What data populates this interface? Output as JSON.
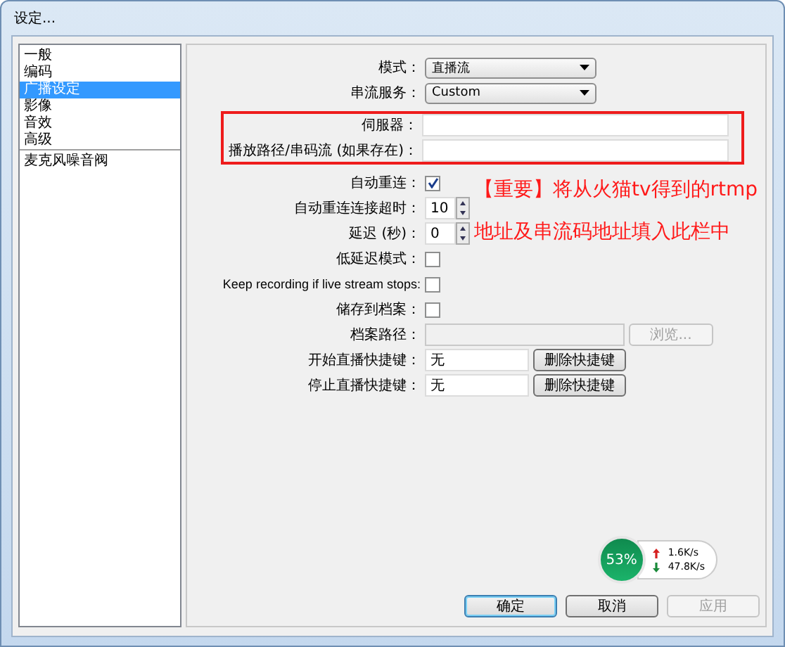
{
  "window": {
    "title": "设定..."
  },
  "sidebar": {
    "sections": [
      {
        "items": [
          {
            "label": "一般",
            "selected": false
          },
          {
            "label": "编码",
            "selected": false
          },
          {
            "label": "广播设定",
            "selected": true
          },
          {
            "label": "影像",
            "selected": false
          },
          {
            "label": "音效",
            "selected": false
          },
          {
            "label": "高级",
            "selected": false
          }
        ]
      },
      {
        "items": [
          {
            "label": "麦克风噪音阀",
            "selected": false
          }
        ]
      }
    ]
  },
  "form": [
    {
      "highlight": false,
      "rows": [
        {
          "kind": "select",
          "label": "模式：",
          "value": "直播流"
        },
        {
          "kind": "select",
          "label": "串流服务：",
          "value": "Custom"
        }
      ]
    },
    {
      "highlight": true,
      "rows": [
        {
          "kind": "text",
          "label": "伺服器："
        },
        {
          "kind": "text",
          "label": "播放路径/串码流 (如果存在)："
        }
      ]
    },
    {
      "highlight": false,
      "rows": [
        {
          "kind": "checkbox",
          "label": "自动重连：",
          "checked": true
        },
        {
          "kind": "spin",
          "label": "自动重连连接超时：",
          "value": "10"
        },
        {
          "kind": "spin",
          "label": "延迟 (秒)：",
          "value": "0"
        },
        {
          "kind": "checkbox",
          "label": "低延迟模式：",
          "checked": false
        },
        {
          "kind": "checkbox",
          "label": "Keep recording if live stream stops:",
          "checked": false
        },
        {
          "kind": "checkbox",
          "label": "储存到档案：",
          "checked": false
        },
        {
          "kind": "path",
          "label": "档案路径：",
          "button": "浏览...",
          "disabled": true
        },
        {
          "kind": "hotkey",
          "label": "开始直播快捷键：",
          "value": "无",
          "button": "删除快捷键"
        },
        {
          "kind": "hotkey",
          "label": "停止直播快捷键：",
          "value": "无",
          "button": "删除快捷键"
        }
      ]
    }
  ],
  "annotation": [
    "【重要】将从火猫tv得到的rtmp",
    "地址及串流码地址填入此栏中"
  ],
  "widget": {
    "percent": "53%",
    "upload": "1.6K/s",
    "download": "47.8K/s"
  },
  "buttons": [
    {
      "label": "确定",
      "default": true,
      "disabled": false
    },
    {
      "label": "取消",
      "default": false,
      "disabled": false
    },
    {
      "label": "应用",
      "default": false,
      "disabled": true
    }
  ]
}
